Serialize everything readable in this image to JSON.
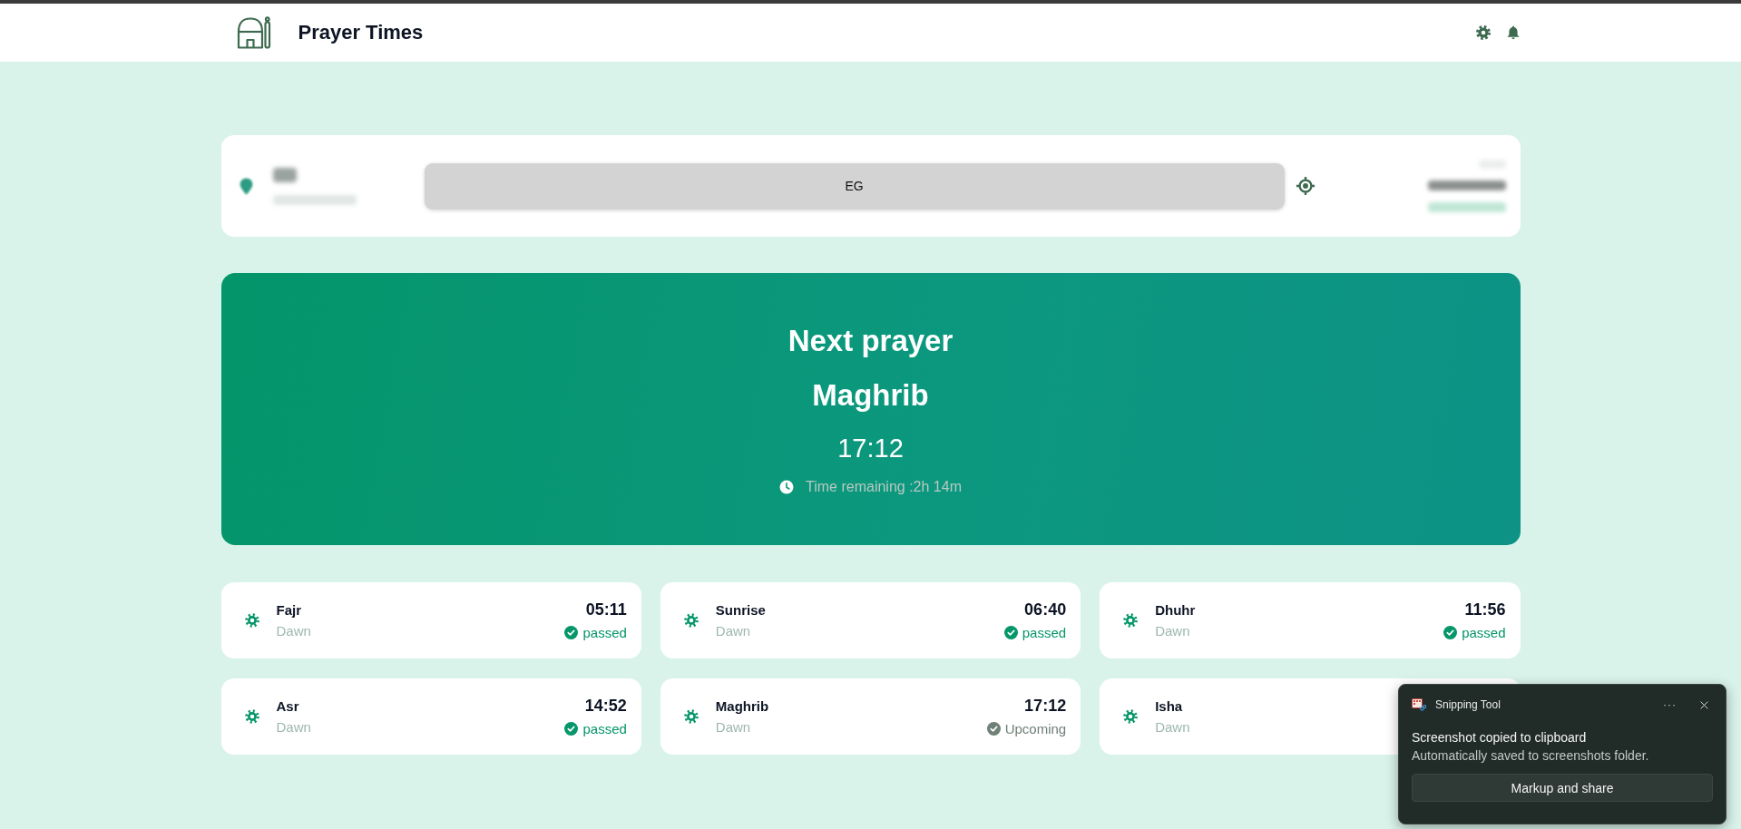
{
  "header": {
    "title": "Prayer Times"
  },
  "location": {
    "country_value": "EG"
  },
  "next_prayer": {
    "heading": "Next prayer",
    "name": "Maghrib",
    "time": "17:12",
    "remaining": "Time remaining :2h 14m"
  },
  "prayers": [
    {
      "name": "Fajr",
      "period": "Dawn",
      "time": "05:11",
      "status": "passed",
      "kind": "passed"
    },
    {
      "name": "Sunrise",
      "period": "Dawn",
      "time": "06:40",
      "status": "passed",
      "kind": "passed"
    },
    {
      "name": "Dhuhr",
      "period": "Dawn",
      "time": "11:56",
      "status": "passed",
      "kind": "passed"
    },
    {
      "name": "Asr",
      "period": "Dawn",
      "time": "14:52",
      "status": "passed",
      "kind": "passed"
    },
    {
      "name": "Maghrib",
      "period": "Dawn",
      "time": "17:12",
      "status": "Upcoming",
      "kind": "upcoming"
    },
    {
      "name": "Isha",
      "period": "Dawn"
    }
  ],
  "notification": {
    "app": "Snipping Tool",
    "more": "···",
    "title": "Screenshot copied to clipboard",
    "message": "Automatically saved to screenshots folder.",
    "button": "Markup and share"
  }
}
